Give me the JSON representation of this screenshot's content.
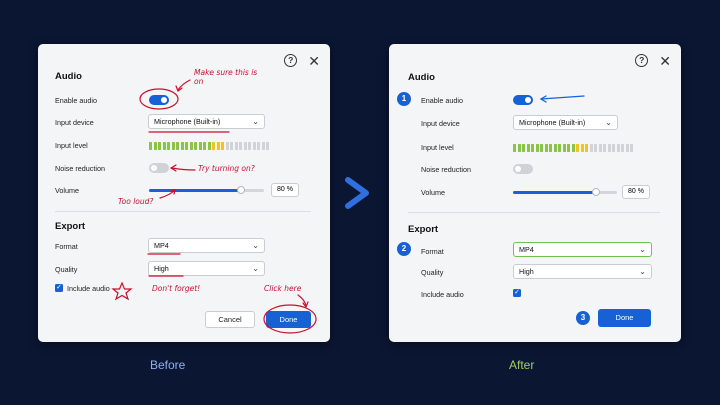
{
  "captions": {
    "before": "Before",
    "after": "After"
  },
  "icons": {
    "help": "?",
    "close": "✕",
    "chevron": "⌄",
    "check": "✓"
  },
  "colors": {
    "primary": "#1662d5",
    "highlight": "#6cc24a",
    "annotation": "#c8102e"
  },
  "dialog": {
    "audio_title": "Audio",
    "enable_audio_label": "Enable audio",
    "enable_audio_on": true,
    "input_device_label": "Input device",
    "input_device_value": "Microphone (Built-in)",
    "input_level_label": "Input level",
    "input_level": {
      "green_bars": 14,
      "yellow_bars": 3,
      "gray_bars": 10,
      "green": "#8bc34a",
      "yellow": "#f0c419",
      "gray": "#d0d3d7"
    },
    "noise_reduction_label": "Noise reduction",
    "noise_reduction_on": false,
    "volume_label": "Volume",
    "volume_percent": 80,
    "volume_display": "80 %",
    "export_title": "Export",
    "format_label": "Format",
    "format_value": "MP4",
    "quality_label": "Quality",
    "quality_value": "High",
    "include_audio_label": "Include audio",
    "include_audio_checked": true,
    "cancel_label": "Cancel",
    "done_label": "Done"
  },
  "annotations": {
    "enable_audio": "Make sure this is on",
    "noise_reduction": "Try turning on?",
    "volume": "Too loud?",
    "include_audio": "Don't forget!",
    "done": "Click here"
  },
  "steps": [
    "1",
    "2",
    "3"
  ]
}
